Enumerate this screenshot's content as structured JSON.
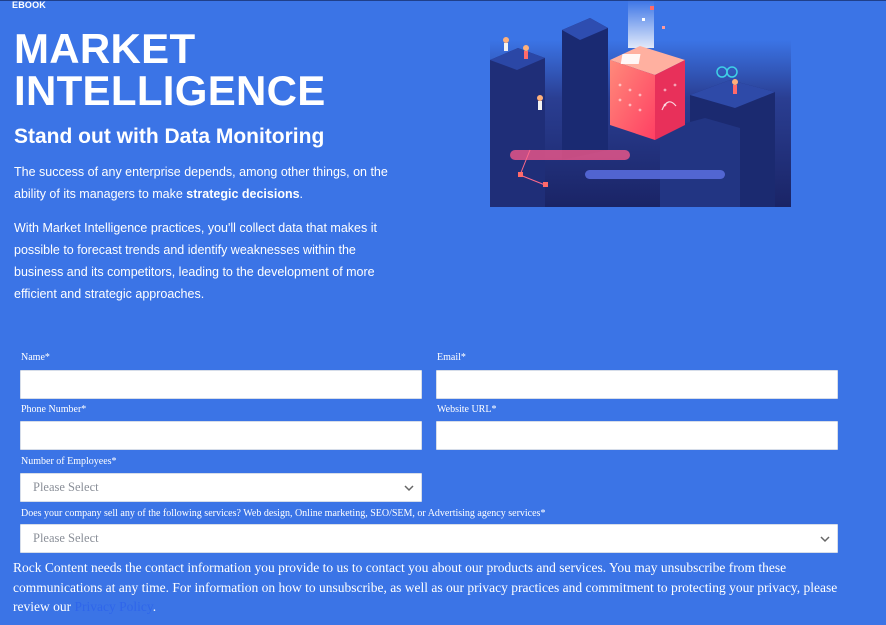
{
  "header": {
    "eyebrow": "EBOOK",
    "title_line1": "MARKET",
    "title_line2": "INTELLIGENCE",
    "subtitle": "Stand out with Data Monitoring"
  },
  "intro": {
    "p1_before": "The success of any enterprise depends, among other things, on the ability of its managers to make ",
    "p1_bold": "strategic decisions",
    "p1_after": ".",
    "p2": "With Market Intelligence practices, you'll collect data that makes it possible to forecast trends and identify weaknesses within the business and its competitors, leading to the development of more efficient and strategic approaches."
  },
  "form": {
    "name_label": "Name*",
    "email_label": "Email*",
    "phone_label": "Phone Number*",
    "website_label": "Website URL*",
    "employees_label": "Number of Employees*",
    "employees_value": "Please Select",
    "services_label": "Does your company sell any of the following services? Web design, Online marketing, SEO/SEM, or Advertising agency services*",
    "services_value": "Please Select"
  },
  "notice": {
    "text": "Rock Content needs the contact information you provide to us to contact you about our products and services. You may unsubscribe from these communications at any time. For information on how to unsubscribe, as well as our privacy practices and commitment to protecting your privacy, please review our ",
    "link": "Privacy Policy",
    "end": "."
  },
  "colors": {
    "background": "#3b74e6",
    "hero_dark": "#1b2a6b",
    "hero_accent": "#ff5a6a",
    "link": "#2f66ea"
  },
  "icons": {
    "select_chevron": "chevron-down-icon"
  }
}
